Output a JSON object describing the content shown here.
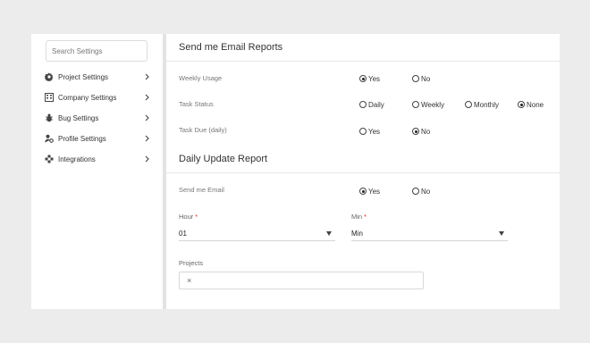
{
  "search": {
    "placeholder": "Search Settings"
  },
  "sidebar": {
    "items": [
      {
        "label": "Project Settings",
        "icon": "gear-icon"
      },
      {
        "label": "Company Settings",
        "icon": "building-icon"
      },
      {
        "label": "Bug Settings",
        "icon": "bug-icon"
      },
      {
        "label": "Profile Settings",
        "icon": "user-settings-icon"
      },
      {
        "label": "Integrations",
        "icon": "puzzle-icon"
      }
    ]
  },
  "email_reports": {
    "title": "Send me Email Reports",
    "weekly_usage": {
      "label": "Weekly Usage",
      "options": [
        "Yes",
        "No"
      ],
      "selected": "Yes"
    },
    "task_status": {
      "label": "Task Status",
      "options": [
        "Daily",
        "Weekly",
        "Monthly",
        "None"
      ],
      "selected": "None"
    },
    "task_due": {
      "label": "Task Due (daily)",
      "options": [
        "Yes",
        "No"
      ],
      "selected": "No"
    }
  },
  "daily_update": {
    "title": "Daily Update Report",
    "send_email": {
      "label": "Send me Email",
      "options": [
        "Yes",
        "No"
      ],
      "selected": "Yes"
    },
    "hour": {
      "label": "Hour",
      "required_mark": "*",
      "value": "01"
    },
    "min": {
      "label": "Min",
      "required_mark": "*",
      "value": "Min"
    },
    "projects": {
      "label": "Projects",
      "clear_symbol": "×"
    }
  },
  "colors": {
    "required": "#e0321f",
    "background": "#ececec",
    "divider": "#e3e3e3"
  }
}
